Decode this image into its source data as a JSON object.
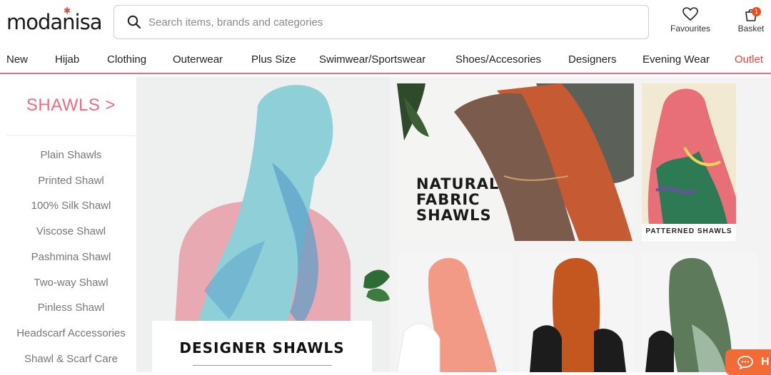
{
  "header": {
    "logo": "modanisa",
    "search_placeholder": "Search items, brands and categories",
    "favourites_label": "Favourites",
    "basket_label": "Basket",
    "basket_count": "1"
  },
  "nav": {
    "items": [
      "New",
      "Hijab",
      "Clothing",
      "Outerwear",
      "Plus Size",
      "Swimwear/Sportswear",
      "Shoes/Accesories",
      "Designers",
      "Evening Wear",
      "Outlet"
    ]
  },
  "sidebar": {
    "title": "SHAWLS >",
    "items": [
      "Plain Shawls",
      "Printed Shawl",
      "100% Silk Shawl",
      "Viscose Shawl",
      "Pashmina Shawl",
      "Two-way Shawl",
      "Pinless Shawl",
      "Headscarf Accessories",
      "Shawl & Scarf Care"
    ]
  },
  "banners": {
    "designer": "DESIGNER SHAWLS",
    "natural_line1": "NATURAL",
    "natural_line2": "FABRIC",
    "natural_line3": "SHAWLS",
    "patterned": "PATTERNED SHAWLS"
  },
  "chat": {
    "label": "H"
  },
  "colors": {
    "accent": "#ef6b7f",
    "outlet": "#e8423b",
    "badge": "#f04a1b",
    "chat": "#f26a35"
  }
}
